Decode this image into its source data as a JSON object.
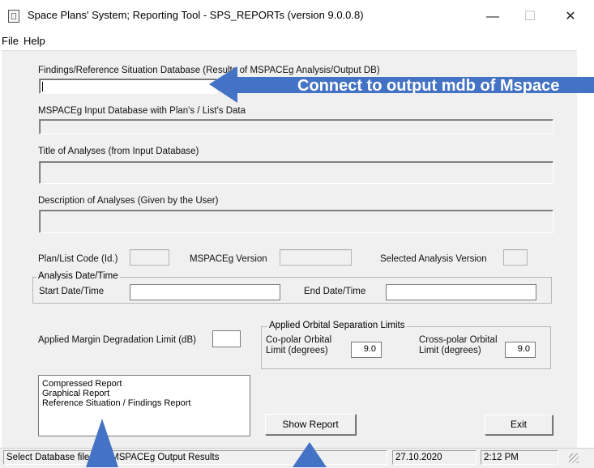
{
  "window": {
    "title": "Space Plans' System; Reporting Tool - SPS_REPORTs (version 9.0.0.8)",
    "minimize_glyph": "—",
    "maximize_glyph": "☐",
    "close_glyph": "✕"
  },
  "menu": {
    "items": [
      "File",
      "Help"
    ]
  },
  "form": {
    "findings_db_label": "Findings/Reference Situation Database (Results of MSPACEg Analysis/Output DB)",
    "findings_db_value": "",
    "input_db_label": "MSPACEg Input Database with Plan's / List's Data",
    "input_db_value": "",
    "title_label": "Title of Analyses (from Input Database)",
    "title_value": "",
    "description_label": "Description of Analyses (Given by the User)",
    "description_value": "",
    "plan_code_label": "Plan/List Code (Id.)",
    "plan_code_value": "",
    "mspaceg_version_label": "MSPACEg Version",
    "mspaceg_version_value": "",
    "selected_version_label": "Selected Analysis Version",
    "selected_version_value": "",
    "date_group_label": "Analysis Date/Time",
    "start_label": "Start Date/Time",
    "start_value": "",
    "end_label": "End Date/Time",
    "end_value": "",
    "margin_label": "Applied Margin Degradation Limit (dB)",
    "margin_value": "",
    "orbital_group_label": "Applied Orbital Separation Limits",
    "copolar_label_1": "Co-polar Orbital",
    "copolar_label_2": "Limit (degrees)",
    "copolar_value": "9.0",
    "crosspolar_label_1": "Cross-polar Orbital",
    "crosspolar_label_2": "Limit (degrees)",
    "crosspolar_value": "9.0"
  },
  "report_list": [
    "Compressed Report",
    "Graphical Report",
    "Reference Situation / Findings Report"
  ],
  "buttons": {
    "show_report": "Show Report",
    "exit": "Exit"
  },
  "status": {
    "message": "Select Database file with MSPACEg Output Results",
    "date": "27.10.2020",
    "time": "2:12 PM"
  },
  "annotation": {
    "text": "Connect to output mdb of Mspace",
    "color": "#4472c4"
  }
}
